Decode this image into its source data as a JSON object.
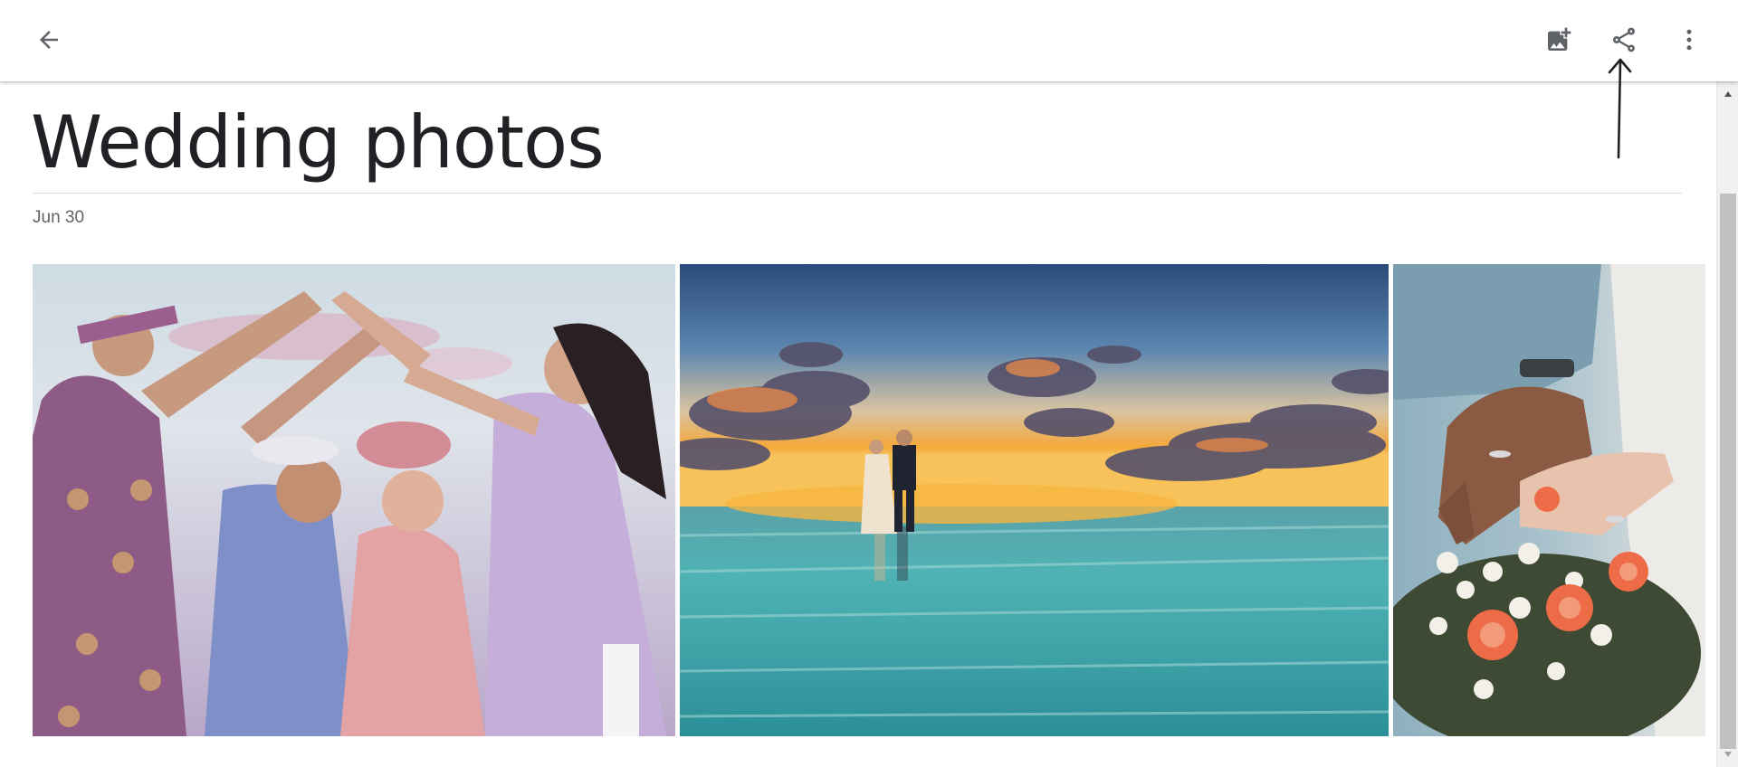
{
  "app_bar": {
    "back_icon": "arrow-back-icon",
    "actions": [
      {
        "name": "add-photos",
        "icon": "add-photo-icon"
      },
      {
        "name": "share",
        "icon": "share-icon"
      },
      {
        "name": "more-options",
        "icon": "more-vert-icon"
      }
    ]
  },
  "album": {
    "title": "Wedding photos",
    "date": "Jun 30"
  },
  "photos": [
    {
      "subject": "wedding-procession-photo"
    },
    {
      "subject": "beach-sunset-couple-photo"
    },
    {
      "subject": "hands-with-rings-bouquet-photo"
    }
  ],
  "colors": {
    "title_text": "#202124",
    "secondary_text": "#5f6368",
    "icon": "#5f6368",
    "divider": "#dadce0",
    "annotation": "#202124"
  }
}
